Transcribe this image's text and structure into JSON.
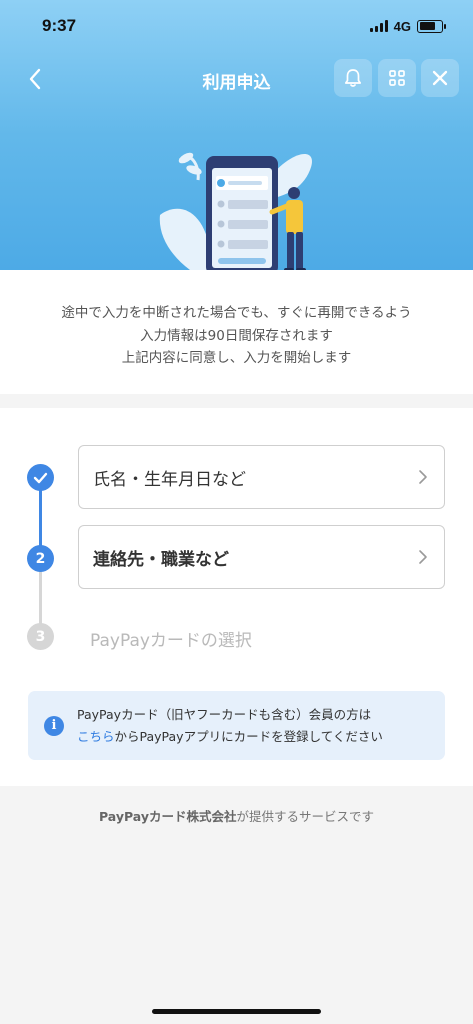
{
  "status_bar": {
    "time": "9:37",
    "network": "4G"
  },
  "navbar": {
    "title": "利用申込",
    "icons": [
      "back-icon",
      "bell-icon",
      "grid-icon",
      "close-icon"
    ]
  },
  "intro": {
    "line1": "途中で入力を中断された場合でも、すぐに再開できるよう",
    "line2": "入力情報は90日間保存されます",
    "line3": "上記内容に同意し、入力を開始します"
  },
  "steps": [
    {
      "number": "1",
      "label": "氏名・生年月日など",
      "state": "completed"
    },
    {
      "number": "2",
      "label": "連絡先・職業など",
      "state": "current"
    },
    {
      "number": "3",
      "label": "PayPayカードの選択",
      "state": "disabled"
    }
  ],
  "info": {
    "line1": "PayPayカード（旧ヤフーカードも含む）会員の方は",
    "link": "こちら",
    "line2_rest": "からPayPayアプリにカードを登録してください"
  },
  "footer": {
    "company": "PayPayカード株式会社",
    "suffix": "が提供するサービスです"
  },
  "colors": {
    "accent": "#3f87e4",
    "hero_top": "#8ed0f5",
    "hero_bottom": "#4daae6",
    "disabled": "#d6d6d6",
    "info_bg": "#e6f0fb"
  }
}
